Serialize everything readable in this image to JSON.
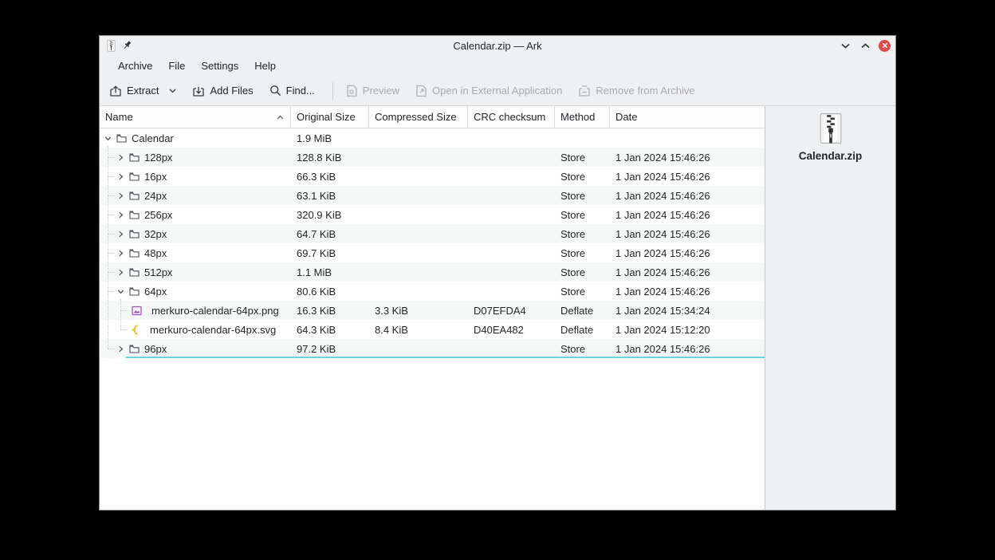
{
  "window": {
    "title": "Calendar.zip — Ark"
  },
  "menubar": {
    "items": [
      {
        "label": "Archive"
      },
      {
        "label": "File"
      },
      {
        "label": "Settings"
      },
      {
        "label": "Help"
      }
    ]
  },
  "toolbar": {
    "buttons": [
      {
        "label": "Extract",
        "icon": "extract-icon",
        "enabled": true,
        "has_dropdown": true
      },
      {
        "label": "Add Files",
        "icon": "add-files-icon",
        "enabled": true,
        "has_dropdown": false
      },
      {
        "label": "Find...",
        "icon": "search-icon",
        "enabled": true,
        "has_dropdown": false
      },
      {
        "label": "Preview",
        "icon": "preview-icon",
        "enabled": false,
        "has_dropdown": false
      },
      {
        "label": "Open in External Application",
        "icon": "open-external-icon",
        "enabled": false,
        "has_dropdown": false
      },
      {
        "label": "Remove from Archive",
        "icon": "remove-from-archive-icon",
        "enabled": false,
        "has_dropdown": false
      }
    ]
  },
  "table": {
    "columns": [
      "Name",
      "Original Size",
      "Compressed Size",
      "CRC checksum",
      "Method",
      "Date"
    ],
    "sort_column": "Name",
    "sort_ascending": true,
    "rows": [
      {
        "name": "Calendar",
        "level": 0,
        "icon": "folder",
        "expander": "expanded",
        "original_size": "1.9 MiB",
        "compressed_size": "",
        "crc": "",
        "method": "",
        "date": ""
      },
      {
        "name": "128px",
        "level": 1,
        "icon": "folder",
        "expander": "collapsed",
        "original_size": "128.8 KiB",
        "compressed_size": "",
        "crc": "",
        "method": "Store",
        "date": "1 Jan 2024 15:46:26"
      },
      {
        "name": "16px",
        "level": 1,
        "icon": "folder",
        "expander": "collapsed",
        "original_size": "66.3 KiB",
        "compressed_size": "",
        "crc": "",
        "method": "Store",
        "date": "1 Jan 2024 15:46:26"
      },
      {
        "name": "24px",
        "level": 1,
        "icon": "folder",
        "expander": "collapsed",
        "original_size": "63.1 KiB",
        "compressed_size": "",
        "crc": "",
        "method": "Store",
        "date": "1 Jan 2024 15:46:26"
      },
      {
        "name": "256px",
        "level": 1,
        "icon": "folder",
        "expander": "collapsed",
        "original_size": "320.9 KiB",
        "compressed_size": "",
        "crc": "",
        "method": "Store",
        "date": "1 Jan 2024 15:46:26"
      },
      {
        "name": "32px",
        "level": 1,
        "icon": "folder",
        "expander": "collapsed",
        "original_size": "64.7 KiB",
        "compressed_size": "",
        "crc": "",
        "method": "Store",
        "date": "1 Jan 2024 15:46:26"
      },
      {
        "name": "48px",
        "level": 1,
        "icon": "folder",
        "expander": "collapsed",
        "original_size": "69.7 KiB",
        "compressed_size": "",
        "crc": "",
        "method": "Store",
        "date": "1 Jan 2024 15:46:26"
      },
      {
        "name": "512px",
        "level": 1,
        "icon": "folder",
        "expander": "collapsed",
        "original_size": "1.1 MiB",
        "compressed_size": "",
        "crc": "",
        "method": "Store",
        "date": "1 Jan 2024 15:46:26"
      },
      {
        "name": "64px",
        "level": 1,
        "icon": "folder",
        "expander": "expanded",
        "original_size": "80.6 KiB",
        "compressed_size": "",
        "crc": "",
        "method": "Store",
        "date": "1 Jan 2024 15:46:26"
      },
      {
        "name": "merkuro-calendar-64px.png",
        "level": 2,
        "icon": "image-png",
        "expander": "none",
        "original_size": "16.3 KiB",
        "compressed_size": "3.3 KiB",
        "crc": "D07EFDA4",
        "method": "Deflate",
        "date": "1 Jan 2024 15:34:24"
      },
      {
        "name": "merkuro-calendar-64px.svg",
        "level": 2,
        "icon": "image-svg",
        "expander": "none",
        "original_size": "64.3 KiB",
        "compressed_size": "8.4 KiB",
        "crc": "D40EA482",
        "method": "Deflate",
        "date": "1 Jan 2024 15:12:20"
      },
      {
        "name": "96px",
        "level": 1,
        "icon": "folder",
        "expander": "collapsed",
        "original_size": "97.2 KiB",
        "compressed_size": "",
        "crc": "",
        "method": "Store",
        "date": "1 Jan 2024 15:46:26"
      }
    ]
  },
  "side_panel": {
    "file_name": "Calendar.zip",
    "icon": "zip-file-icon"
  },
  "colors": {
    "chrome_bg": "#eff0f1",
    "close_button": "#dd4c4c",
    "stripe": "#f6f7f7",
    "drop_indicator": "#6fcdf1"
  }
}
